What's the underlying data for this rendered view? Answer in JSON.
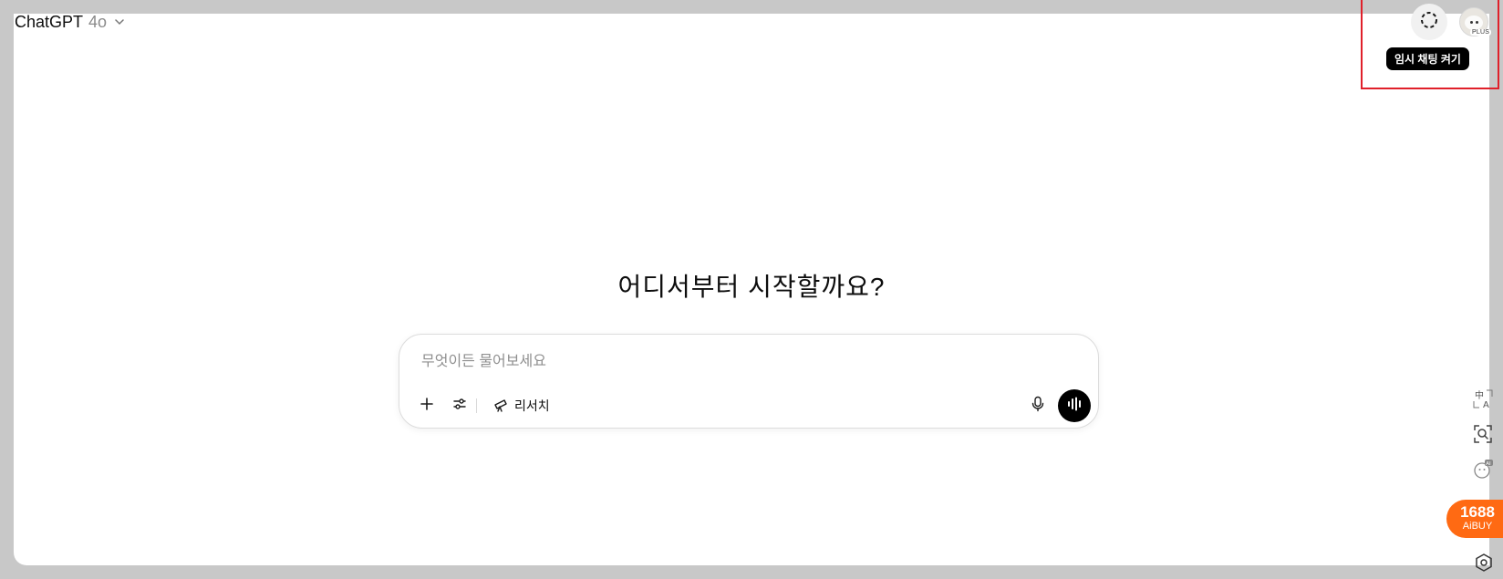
{
  "header": {
    "app_name": "ChatGPT",
    "model_version": "4o",
    "temporary_chat_tooltip": "임시 채팅 켜기",
    "plan_badge": "PLUS"
  },
  "main": {
    "headline": "어디서부터 시작할까요?"
  },
  "composer": {
    "placeholder": "무엇이든 물어보세요",
    "value": "",
    "research_label": "리서치"
  },
  "side_tools": {
    "icons": [
      "translate-icon",
      "screen-search-icon",
      "ai-assistant-icon",
      "settings-hex-icon"
    ],
    "aibuy_number": "1688",
    "aibuy_text": "AiBUY"
  },
  "colors": {
    "page_background": "#c8c8c8",
    "surface": "#ffffff",
    "tooltip_bg": "#000000",
    "highlight_border": "#e0202a",
    "aibuy_orange": "#ff6a13"
  }
}
